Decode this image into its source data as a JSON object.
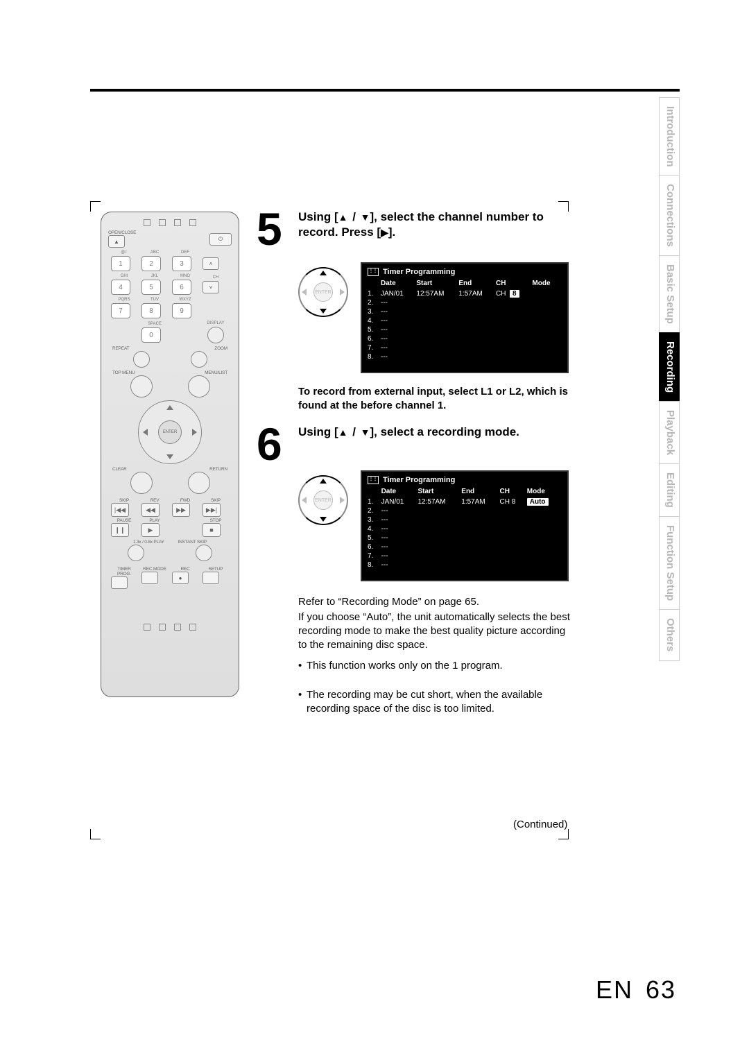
{
  "page": {
    "lang": "EN",
    "number": "63",
    "continued": "(Continued)"
  },
  "tabs": [
    "Introduction",
    "Connections",
    "Basic Setup",
    "Recording",
    "Playback",
    "Editing",
    "Function Setup",
    "Others"
  ],
  "active_tab_index": 3,
  "step5": {
    "num": "5",
    "title_pre": "Using [",
    "title_mid": " / ",
    "title_post": "], select the channel number to record. Press [",
    "title_end": "].",
    "note": "To record from external input, select L1 or L2, which is found at the before channel 1.",
    "osd": {
      "title": "Timer Programming",
      "headers": [
        "Date",
        "Start",
        "End",
        "CH",
        "Mode"
      ],
      "rows": [
        {
          "n": "1.",
          "date": "JAN/01",
          "start": "12:57AM",
          "end": "1:57AM",
          "ch_lbl": "CH",
          "ch_val": "8",
          "mode": ""
        },
        {
          "n": "2.",
          "date": "---"
        },
        {
          "n": "3.",
          "date": "---"
        },
        {
          "n": "4.",
          "date": "---"
        },
        {
          "n": "5.",
          "date": "---"
        },
        {
          "n": "6.",
          "date": "---"
        },
        {
          "n": "7.",
          "date": "---"
        },
        {
          "n": "8.",
          "date": "---"
        }
      ]
    },
    "dpad_center": "ENTER"
  },
  "step6": {
    "num": "6",
    "title_pre": "Using [",
    "title_mid": " / ",
    "title_post": "], select a recording mode.",
    "osd": {
      "title": "Timer Programming",
      "headers": [
        "Date",
        "Start",
        "End",
        "CH",
        "Mode"
      ],
      "rows": [
        {
          "n": "1.",
          "date": "JAN/01",
          "start": "12:57AM",
          "end": "1:57AM",
          "ch": "CH   8",
          "mode": "Auto"
        },
        {
          "n": "2.",
          "date": "---"
        },
        {
          "n": "3.",
          "date": "---"
        },
        {
          "n": "4.",
          "date": "---"
        },
        {
          "n": "5.",
          "date": "---"
        },
        {
          "n": "6.",
          "date": "---"
        },
        {
          "n": "7.",
          "date": "---"
        },
        {
          "n": "8.",
          "date": "---"
        }
      ]
    },
    "dpad_center": "ENTER",
    "para1": "Refer to “Recording Mode” on page 65.",
    "para2": "If you choose “Auto”, the unit automatically selects the best recording mode to make the best quality picture according to the remaining disc space.",
    "bullet1": "This function works only on the 1 program.",
    "bullet2": "The recording may be cut short, when the available recording space of the disc is too limited."
  },
  "remote": {
    "open_close": "OPEN/CLOSE",
    "keypad_sub": [
      "@/:",
      "ABC",
      "DEF",
      "",
      "GHI",
      "JKL",
      "MNO",
      "CH",
      "PQRS",
      "TUV",
      "WXYZ",
      "",
      "",
      "SPACE",
      "",
      "DISPLAY"
    ],
    "numbers": [
      "1",
      "2",
      "3",
      "",
      "4",
      "5",
      "6",
      "",
      "7",
      "8",
      "9",
      "",
      "",
      "0",
      "",
      ""
    ],
    "repeat": "REPEAT",
    "zoom": "ZOOM",
    "topmenu": "TOP MENU",
    "menulist": "MENU/LIST",
    "enter": "ENTER",
    "clear": "CLEAR",
    "return": "RETURN",
    "trans_labels": [
      "SKIP",
      "REV",
      "FWD",
      "SKIP",
      "PAUSE",
      "PLAY",
      "",
      "STOP"
    ],
    "trans_sym": [
      "|◀◀",
      "◀◀",
      "▶▶",
      "▶▶|",
      "❙❙",
      "▶",
      "",
      "■"
    ],
    "speed": "1.3x / 0.8x PLAY",
    "instant": "INSTANT SKIP",
    "bottom_labels": [
      "TIMER PROG.",
      "REC MODE",
      "REC",
      "SETUP"
    ]
  }
}
